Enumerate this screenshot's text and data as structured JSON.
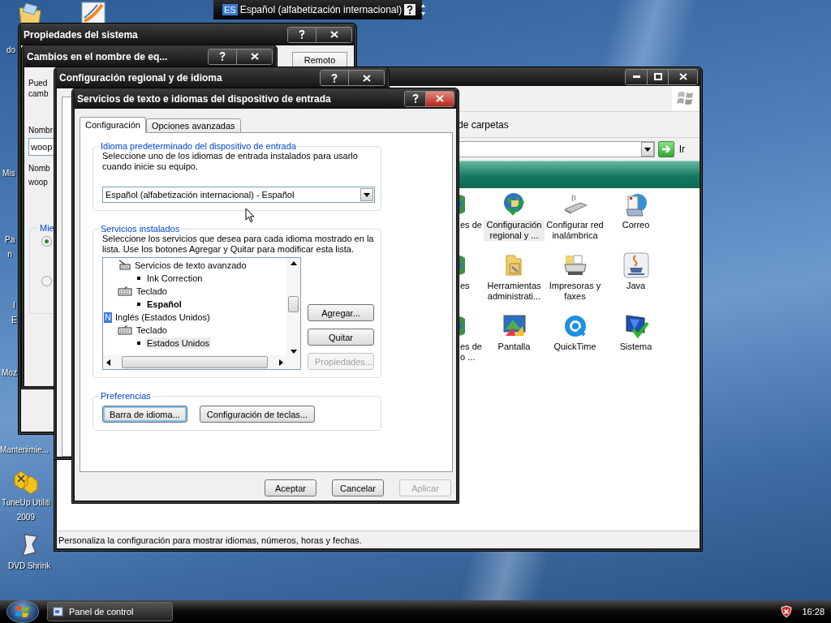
{
  "language_bar": {
    "badge": "ES",
    "label": "Español (alfabetización internacional)"
  },
  "desktop_icons": [
    {
      "kind": "folder",
      "lines": [
        "do"
      ]
    },
    {
      "kind": "chart"
    },
    {
      "kind": "hidden",
      "lines": [
        "Mis"
      ]
    },
    {
      "kind": "hidden",
      "lines": [
        "Pa",
        "n"
      ]
    },
    {
      "kind": "hidden",
      "lines": [
        "I",
        "E"
      ]
    },
    {
      "kind": "hidden",
      "lines": [
        "Moz"
      ]
    },
    {
      "kind": "hidden",
      "lines": [
        "Mantenimie..."
      ]
    },
    {
      "kind": "tuneup",
      "lines": [
        "TuneUp Utiliti",
        "2009"
      ]
    },
    {
      "kind": "dvd",
      "lines": [
        "DVD Shrink"
      ]
    }
  ],
  "control_panel": {
    "active": false,
    "toolbar_text": "de carpetas",
    "go_label": "Ir",
    "items": [
      {
        "kind": "partial",
        "label": "es de",
        "selected": false
      },
      {
        "kind": "regional",
        "label": "Configuración regional y ...",
        "selected": true
      },
      {
        "kind": "wireless",
        "label": "Configurar red inalámbrica",
        "selected": false
      },
      {
        "kind": "mail",
        "label": "Correo",
        "selected": false
      },
      {
        "kind": "partial",
        "label": "es",
        "selected": false
      },
      {
        "kind": "tools",
        "label": "Herramientas administrati...",
        "selected": false
      },
      {
        "kind": "printer",
        "label": "Impresoras y faxes",
        "selected": false
      },
      {
        "kind": "java",
        "label": "Java",
        "selected": false
      },
      {
        "kind": "partial",
        "label": "es de\no ...",
        "selected": false
      },
      {
        "kind": "display",
        "label": "Pantalla",
        "selected": false
      },
      {
        "kind": "quicktime",
        "label": "QuickTime",
        "selected": false
      },
      {
        "kind": "system",
        "label": "Sistema",
        "selected": false
      }
    ],
    "status": "Personaliza la configuración para mostrar idiomas, números, horas y fechas."
  },
  "system_properties": {
    "title": "Propiedades del sistema",
    "active": false,
    "tab": "Remoto"
  },
  "computer_name_changes": {
    "title": "Cambios en el nombre de eq...",
    "active": false,
    "intro": [
      "Pued",
      "camb"
    ],
    "name_label": "Nombr",
    "name_value": "woop",
    "full_name_label": "Nomb",
    "full_name_value": "woop",
    "group_label": "Mie",
    "radios": [
      {
        "selected": true
      },
      {
        "selected": false
      }
    ]
  },
  "regional_settings": {
    "title": "Configuración regional y de idioma",
    "active": false
  },
  "dialog": {
    "title": "Servicios de texto e idiomas del dispositivo de entrada",
    "active": true,
    "tabs": [
      {
        "label": "Configuración",
        "selected": true
      },
      {
        "label": "Opciones avanzadas",
        "selected": false
      }
    ],
    "default_language": {
      "title": "Idioma predeterminado del dispositivo de entrada",
      "text": "Seleccione uno de los idiomas de entrada instalados para usarlo cuando inicie su equipo.",
      "value": "Español (alfabetización internacional) - Español"
    },
    "installed": {
      "title": "Servicios instalados",
      "text": "Seleccione los servicios que desea para cada idioma mostrado en la lista. Use los botones Agregar y Quitar para modificar esta lista.",
      "continued_services": [
        {
          "kind": "text_services",
          "label": "Servicios de texto avanzado",
          "selected": false,
          "children": [
            {
              "kind": "layout",
              "label": "Ink Correction",
              "default": false,
              "selected": false
            }
          ]
        },
        {
          "kind": "keyboard",
          "label": "Teclado",
          "selected": false,
          "children": [
            {
              "kind": "layout",
              "label": "Español",
              "default": true,
              "selected": false
            }
          ]
        }
      ],
      "languages": [
        {
          "kind": "language",
          "badge": "N",
          "label": "Inglés (Estados Unidos)",
          "selected": false,
          "children": [
            {
              "kind": "keyboard",
              "label": "Teclado",
              "selected": false,
              "children": [
                {
                  "kind": "layout",
                  "label": "Estados Unidos",
                  "default": false,
                  "selected": true
                }
              ]
            }
          ]
        }
      ],
      "buttons": [
        {
          "label": "Agregar...",
          "disabled": false
        },
        {
          "label": "Quitar",
          "disabled": false
        },
        {
          "label": "Propiedades...",
          "disabled": true
        }
      ]
    },
    "preferences": {
      "title": "Preferencias",
      "buttons": [
        {
          "label": "Barra de idioma...",
          "focused": true
        },
        {
          "label": "Configuración de teclas...",
          "focused": false
        }
      ]
    },
    "buttons": [
      {
        "label": "Aceptar",
        "disabled": false
      },
      {
        "label": "Cancelar",
        "disabled": false
      },
      {
        "label": "Aplicar",
        "disabled": true
      }
    ]
  },
  "taskbar": {
    "tasks": [
      {
        "label": "Panel de control"
      }
    ],
    "clock": "16:28"
  }
}
